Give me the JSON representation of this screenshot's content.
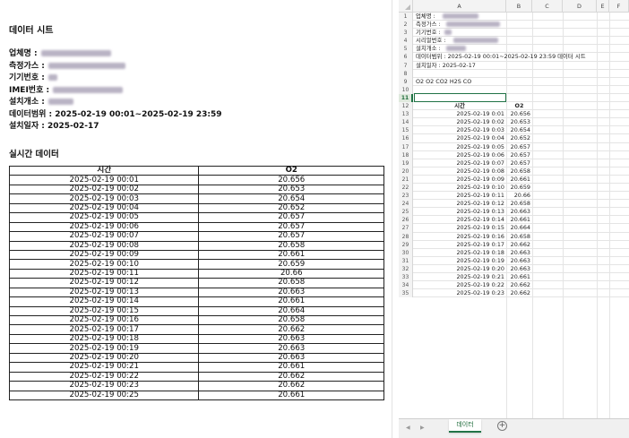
{
  "document": {
    "title": "데이터 시트",
    "info_labels": {
      "company": "업체명 :",
      "gas_station": "측정가스 :",
      "device_no": "기기번호 :",
      "imei_no": "IMEI번호 :",
      "install_place": "설치개소 :",
      "data_range": "데이터범위 : 2025-02-19 00:01~2025-02-19 23:59",
      "install_date": "설치일자 : 2025-02-17"
    },
    "section_title": "실시간 데이터",
    "table": {
      "headers": [
        "시간",
        "O2"
      ],
      "rows": [
        [
          "2025-02-19 00:01",
          "20.656"
        ],
        [
          "2025-02-19 00:02",
          "20.653"
        ],
        [
          "2025-02-19 00:03",
          "20.654"
        ],
        [
          "2025-02-19 00:04",
          "20.652"
        ],
        [
          "2025-02-19 00:05",
          "20.657"
        ],
        [
          "2025-02-19 00:06",
          "20.657"
        ],
        [
          "2025-02-19 00:07",
          "20.657"
        ],
        [
          "2025-02-19 00:08",
          "20.658"
        ],
        [
          "2025-02-19 00:09",
          "20.661"
        ],
        [
          "2025-02-19 00:10",
          "20.659"
        ],
        [
          "2025-02-19 00:11",
          "20.66"
        ],
        [
          "2025-02-19 00:12",
          "20.658"
        ],
        [
          "2025-02-19 00:13",
          "20.663"
        ],
        [
          "2025-02-19 00:14",
          "20.661"
        ],
        [
          "2025-02-19 00:15",
          "20.664"
        ],
        [
          "2025-02-19 00:16",
          "20.658"
        ],
        [
          "2025-02-19 00:17",
          "20.662"
        ],
        [
          "2025-02-19 00:18",
          "20.663"
        ],
        [
          "2025-02-19 00:19",
          "20.663"
        ],
        [
          "2025-02-19 00:20",
          "20.663"
        ],
        [
          "2025-02-19 00:21",
          "20.661"
        ],
        [
          "2025-02-19 00:22",
          "20.662"
        ],
        [
          "2025-02-19 00:23",
          "20.662"
        ],
        [
          "2025-02-19 00:25",
          "20.661"
        ]
      ]
    }
  },
  "spreadsheet": {
    "columns": [
      "A",
      "B",
      "C",
      "D",
      "E",
      "F"
    ],
    "info_rows": [
      {
        "row": "1",
        "text": "업체명 :"
      },
      {
        "row": "2",
        "text": "측정가스 :"
      },
      {
        "row": "3",
        "text": "기기번호 :"
      },
      {
        "row": "4",
        "text": "시리얼번호 :"
      },
      {
        "row": "5",
        "text": "설치개소 :"
      },
      {
        "row": "6",
        "text": "데이터범위 : 2025-02-19 00:01~2025-02-19 23:59 데이터 시트"
      },
      {
        "row": "7",
        "text": "설치일자 : 2025-02-17"
      },
      {
        "row": "8",
        "text": ""
      },
      {
        "row": "9",
        "text": "O2 O2 CO2 H2S CO"
      },
      {
        "row": "10",
        "text": ""
      },
      {
        "row": "11",
        "text": ""
      }
    ],
    "selected_row": "11",
    "header_row": {
      "row": "12",
      "time": "시간",
      "value": "O2"
    },
    "data_rows": [
      {
        "row": "13",
        "time": "2025-02-19 0:01",
        "value": "20.656"
      },
      {
        "row": "14",
        "time": "2025-02-19 0:02",
        "value": "20.653"
      },
      {
        "row": "15",
        "time": "2025-02-19 0:03",
        "value": "20.654"
      },
      {
        "row": "16",
        "time": "2025-02-19 0:04",
        "value": "20.652"
      },
      {
        "row": "17",
        "time": "2025-02-19 0:05",
        "value": "20.657"
      },
      {
        "row": "18",
        "time": "2025-02-19 0:06",
        "value": "20.657"
      },
      {
        "row": "19",
        "time": "2025-02-19 0:07",
        "value": "20.657"
      },
      {
        "row": "20",
        "time": "2025-02-19 0:08",
        "value": "20.658"
      },
      {
        "row": "21",
        "time": "2025-02-19 0:09",
        "value": "20.661"
      },
      {
        "row": "22",
        "time": "2025-02-19 0:10",
        "value": "20.659"
      },
      {
        "row": "23",
        "time": "2025-02-19 0:11",
        "value": "20.66"
      },
      {
        "row": "24",
        "time": "2025-02-19 0:12",
        "value": "20.658"
      },
      {
        "row": "25",
        "time": "2025-02-19 0:13",
        "value": "20.663"
      },
      {
        "row": "26",
        "time": "2025-02-19 0:14",
        "value": "20.661"
      },
      {
        "row": "27",
        "time": "2025-02-19 0:15",
        "value": "20.664"
      },
      {
        "row": "28",
        "time": "2025-02-19 0:16",
        "value": "20.658"
      },
      {
        "row": "29",
        "time": "2025-02-19 0:17",
        "value": "20.662"
      },
      {
        "row": "30",
        "time": "2025-02-19 0:18",
        "value": "20.663"
      },
      {
        "row": "31",
        "time": "2025-02-19 0:19",
        "value": "20.663"
      },
      {
        "row": "32",
        "time": "2025-02-19 0:20",
        "value": "20.663"
      },
      {
        "row": "33",
        "time": "2025-02-19 0:21",
        "value": "20.661"
      },
      {
        "row": "34",
        "time": "2025-02-19 0:22",
        "value": "20.662"
      },
      {
        "row": "35",
        "time": "2025-02-19 0:23",
        "value": "20.662"
      }
    ],
    "sheet_tab": "데이터",
    "add_sheet_symbol": "+",
    "nav_prev": "◀",
    "nav_next": "▶",
    "accent_color": "#217346"
  }
}
